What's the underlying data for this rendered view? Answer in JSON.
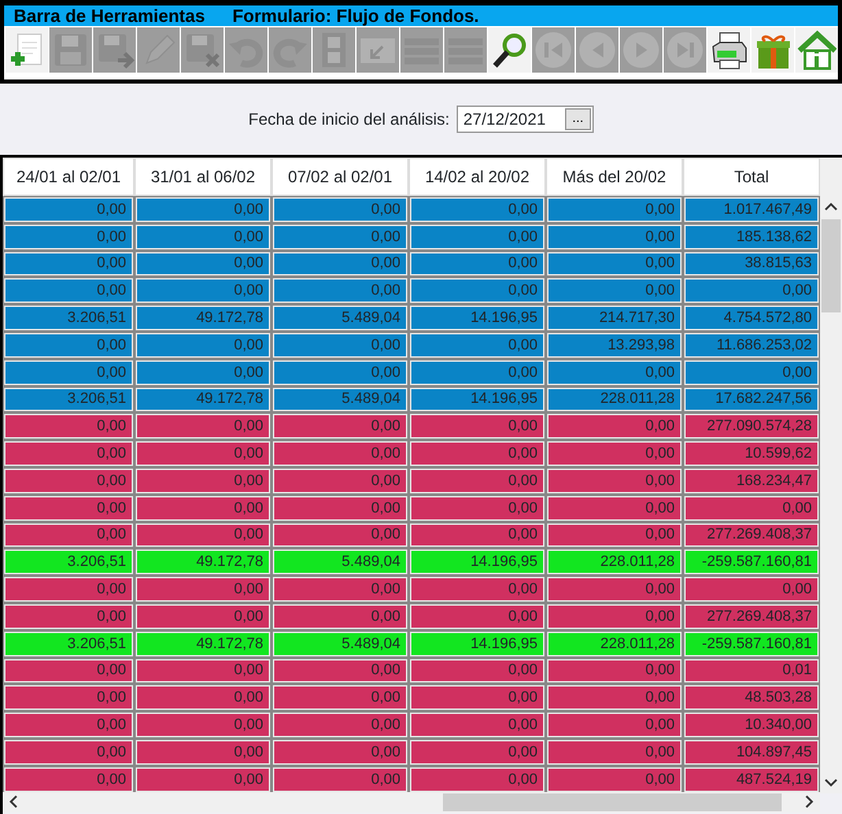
{
  "title_bar": {
    "section": "Barra de Herramientas",
    "form": "Formulario: Flujo de Fondos."
  },
  "toolbar": [
    {
      "kind": "new",
      "disabled": false
    },
    {
      "kind": "save",
      "disabled": true
    },
    {
      "kind": "save-as",
      "disabled": true
    },
    {
      "kind": "edit",
      "disabled": true
    },
    {
      "kind": "save-delete",
      "disabled": true
    },
    {
      "kind": "undo",
      "disabled": true
    },
    {
      "kind": "redo",
      "disabled": true
    },
    {
      "kind": "film",
      "disabled": true
    },
    {
      "kind": "doc-arrow",
      "disabled": true
    },
    {
      "kind": "list",
      "disabled": true
    },
    {
      "kind": "list",
      "disabled": true
    },
    {
      "kind": "search",
      "disabled": false
    },
    {
      "kind": "first",
      "disabled": true
    },
    {
      "kind": "prev",
      "disabled": true
    },
    {
      "kind": "next",
      "disabled": true
    },
    {
      "kind": "last",
      "disabled": true
    },
    {
      "kind": "printer",
      "disabled": false
    },
    {
      "kind": "gift",
      "disabled": false
    },
    {
      "kind": "home",
      "disabled": false
    }
  ],
  "date_field": {
    "label": "Fecha de inicio del análisis:",
    "value": "27/12/2021",
    "button": "..."
  },
  "table": {
    "columns": [
      "24/01 al 02/01",
      "31/01 al 06/02",
      "07/02 al 02/01",
      "14/02 al 20/02",
      "Más del 20/02",
      "Total"
    ],
    "rows": [
      {
        "color": "#0a84c6",
        "cells": [
          "0,00",
          "0,00",
          "0,00",
          "0,00",
          "0,00",
          "1.017.467,49"
        ]
      },
      {
        "color": "#0a84c6",
        "cells": [
          "0,00",
          "0,00",
          "0,00",
          "0,00",
          "0,00",
          "185.138,62"
        ]
      },
      {
        "color": "#0a84c6",
        "cells": [
          "0,00",
          "0,00",
          "0,00",
          "0,00",
          "0,00",
          "38.815,63"
        ]
      },
      {
        "color": "#0a84c6",
        "cells": [
          "0,00",
          "0,00",
          "0,00",
          "0,00",
          "0,00",
          "0,00"
        ]
      },
      {
        "color": "#0a84c6",
        "cells": [
          "3.206,51",
          "49.172,78",
          "5.489,04",
          "14.196,95",
          "214.717,30",
          "4.754.572,80"
        ]
      },
      {
        "color": "#0a84c6",
        "cells": [
          "0,00",
          "0,00",
          "0,00",
          "0,00",
          "13.293,98",
          "11.686.253,02"
        ]
      },
      {
        "color": "#0a84c6",
        "cells": [
          "0,00",
          "0,00",
          "0,00",
          "0,00",
          "0,00",
          "0,00"
        ]
      },
      {
        "color": "#0a84c6",
        "cells": [
          "3.206,51",
          "49.172,78",
          "5.489,04",
          "14.196,95",
          "228.011,28",
          "17.682.247,56"
        ]
      },
      {
        "color": "#d03060",
        "cells": [
          "0,00",
          "0,00",
          "0,00",
          "0,00",
          "0,00",
          "277.090.574,28"
        ]
      },
      {
        "color": "#d03060",
        "cells": [
          "0,00",
          "0,00",
          "0,00",
          "0,00",
          "0,00",
          "10.599,62"
        ]
      },
      {
        "color": "#d03060",
        "cells": [
          "0,00",
          "0,00",
          "0,00",
          "0,00",
          "0,00",
          "168.234,47"
        ]
      },
      {
        "color": "#d03060",
        "cells": [
          "0,00",
          "0,00",
          "0,00",
          "0,00",
          "0,00",
          "0,00"
        ]
      },
      {
        "color": "#d03060",
        "cells": [
          "0,00",
          "0,00",
          "0,00",
          "0,00",
          "0,00",
          "277.269.408,37"
        ]
      },
      {
        "color": "#12e620",
        "cells": [
          "3.206,51",
          "49.172,78",
          "5.489,04",
          "14.196,95",
          "228.011,28",
          "-259.587.160,81"
        ]
      },
      {
        "color": "#d03060",
        "cells": [
          "0,00",
          "0,00",
          "0,00",
          "0,00",
          "0,00",
          "0,00"
        ]
      },
      {
        "color": "#d03060",
        "cells": [
          "0,00",
          "0,00",
          "0,00",
          "0,00",
          "0,00",
          "277.269.408,37"
        ]
      },
      {
        "color": "#12e620",
        "cells": [
          "3.206,51",
          "49.172,78",
          "5.489,04",
          "14.196,95",
          "228.011,28",
          "-259.587.160,81"
        ]
      },
      {
        "color": "#d03060",
        "cells": [
          "0,00",
          "0,00",
          "0,00",
          "0,00",
          "0,00",
          "0,01"
        ]
      },
      {
        "color": "#d03060",
        "cells": [
          "0,00",
          "0,00",
          "0,00",
          "0,00",
          "0,00",
          "48.503,28"
        ]
      },
      {
        "color": "#d03060",
        "cells": [
          "0,00",
          "0,00",
          "0,00",
          "0,00",
          "0,00",
          "10.340,00"
        ]
      },
      {
        "color": "#d03060",
        "cells": [
          "0,00",
          "0,00",
          "0,00",
          "0,00",
          "0,00",
          "104.897,45"
        ]
      },
      {
        "color": "#d03060",
        "cells": [
          "0,00",
          "0,00",
          "0,00",
          "0,00",
          "0,00",
          "487.524,19"
        ]
      }
    ]
  }
}
